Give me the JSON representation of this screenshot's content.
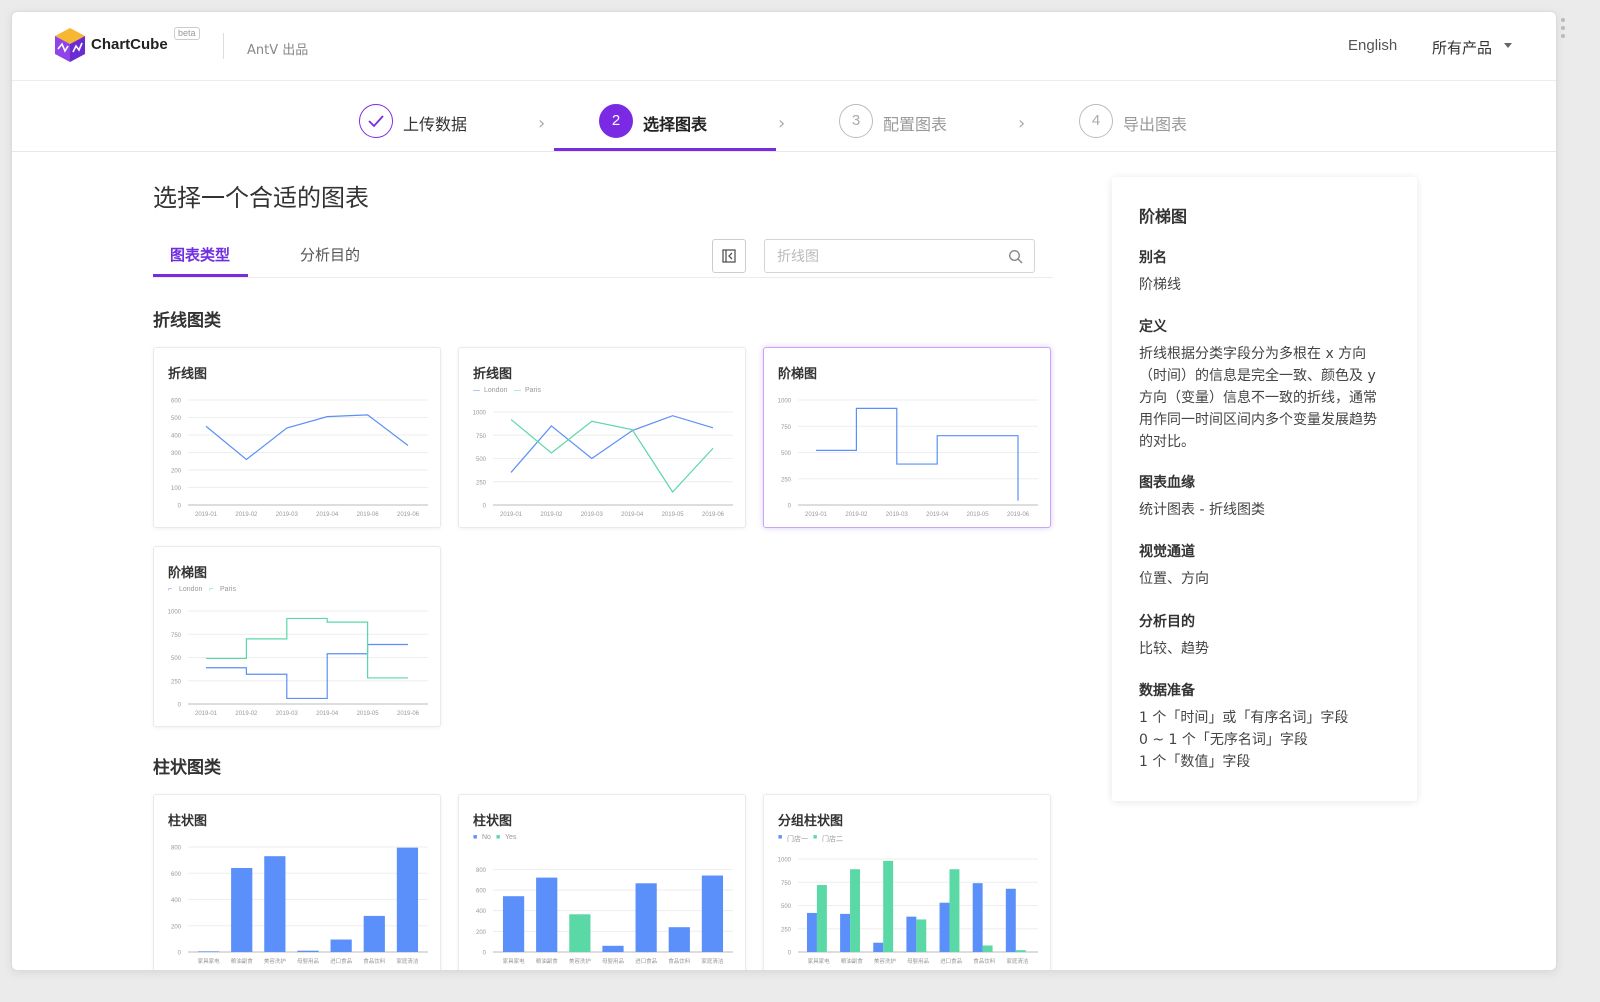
{
  "header": {
    "brand": "ChartCube",
    "beta": "beta",
    "sub": "AntV 出品",
    "lang": "English",
    "products": "所有产品"
  },
  "steps": [
    {
      "num": "",
      "label": "上传数据",
      "state": "done"
    },
    {
      "num": "2",
      "label": "选择图表",
      "state": "active"
    },
    {
      "num": "3",
      "label": "配置图表",
      "state": "todo"
    },
    {
      "num": "4",
      "label": "导出图表",
      "state": "todo"
    }
  ],
  "main": {
    "title": "选择一个合适的图表",
    "tabs": [
      "图表类型",
      "分析目的"
    ],
    "search_placeholder": "折线图"
  },
  "sections": {
    "line": "折线图类",
    "bar": "柱状图类"
  },
  "cards": {
    "c1": {
      "title": "折线图"
    },
    "c2": {
      "title": "折线图",
      "legend": [
        "London",
        "Paris"
      ]
    },
    "c3": {
      "title": "阶梯图"
    },
    "c4": {
      "title": "阶梯图",
      "legend": [
        "London",
        "Paris"
      ]
    },
    "c5": {
      "title": "柱状图"
    },
    "c6": {
      "title": "柱状图",
      "legend": [
        "No",
        "Yes"
      ]
    },
    "c7": {
      "title": "分组柱状图",
      "legend": [
        "门店一",
        "门店二"
      ]
    }
  },
  "detail": {
    "title": "阶梯图",
    "alias_h": "别名",
    "alias": "阶梯线",
    "def_h": "定义",
    "def": "折线根据分类字段分为多根在 x 方向（时间）的信息是完全一致、颜色及 y 方向（变量）信息不一致的折线，通常用作同一时间区间内多个变量发展趋势的对比。",
    "lineage_h": "图表血缘",
    "lineage": "统计图表 - 折线图类",
    "visual_h": "视觉通道",
    "visual": "位置、方向",
    "purpose_h": "分析目的",
    "purpose": "比较、趋势",
    "prep_h": "数据准备",
    "prep": [
      "1 个「时间」或「有序名词」字段",
      "0 ~ 1 个「无序名词」字段",
      "1 个「数值」字段"
    ]
  },
  "colors": {
    "primary": "#7b2ae3",
    "blue": "#5b8ff9",
    "green": "#5ad8a6"
  },
  "chart_data": [
    {
      "type": "line",
      "title": "折线图",
      "x": [
        "2019-01",
        "2019-02",
        "2019-03",
        "2019-04",
        "2019-05",
        "2019-06"
      ],
      "values": [
        450,
        260,
        440,
        505,
        515,
        340
      ],
      "yticks": [
        0,
        100,
        200,
        300,
        400,
        500,
        600
      ],
      "xticks": [
        "2019-01",
        "2019-02",
        "2019-03",
        "2019-04",
        "2019-06",
        "2019-06"
      ],
      "ylim": [
        0,
        600
      ]
    },
    {
      "type": "line",
      "title": "折线图",
      "x": [
        "2019-01",
        "2019-02",
        "2019-03",
        "2019-04",
        "2019-05",
        "2019-06"
      ],
      "series": [
        {
          "name": "London",
          "values": [
            350,
            850,
            500,
            800,
            960,
            830
          ]
        },
        {
          "name": "Paris",
          "values": [
            920,
            560,
            900,
            810,
            140,
            610
          ]
        }
      ],
      "yticks": [
        0,
        250,
        500,
        750,
        1000
      ],
      "xticks": [
        "2019-01",
        "2019-02",
        "2019-03",
        "2019-04",
        "2019-05",
        "2019-06"
      ],
      "ylim": [
        0,
        1000
      ]
    },
    {
      "type": "line",
      "title": "阶梯图",
      "x": [
        "2019-01",
        "2019-02",
        "2019-03",
        "2019-04",
        "2019-05",
        "2019-06"
      ],
      "values": [
        520,
        920,
        390,
        660,
        660,
        40
      ],
      "yticks": [
        0,
        250,
        500,
        750,
        1000
      ],
      "xticks": [
        "2019-01",
        "2019-02",
        "2019-03",
        "2019-04",
        "2019-05",
        "2019-06"
      ],
      "ylim": [
        0,
        1000
      ]
    },
    {
      "type": "line",
      "title": "阶梯图",
      "x": [
        "2019-01",
        "2019-02",
        "2019-03",
        "2019-04",
        "2019-05",
        "2019-06"
      ],
      "series": [
        {
          "name": "London",
          "values": [
            390,
            320,
            60,
            540,
            640,
            640
          ]
        },
        {
          "name": "Paris",
          "values": [
            490,
            700,
            920,
            880,
            280,
            280
          ]
        }
      ],
      "yticks": [
        0,
        250,
        500,
        750,
        1000
      ],
      "xticks": [
        "2019-01",
        "2019-02",
        "2019-03",
        "2019-04",
        "2019-05",
        "2019-06"
      ],
      "ylim": [
        0,
        1000
      ]
    },
    {
      "type": "bar",
      "title": "柱状图",
      "categories": [
        "家具家电",
        "粮油副食",
        "美容洗护",
        "母婴用品",
        "进口食品",
        "食品饮料",
        "家庭清洁"
      ],
      "values": [
        5,
        640,
        730,
        10,
        95,
        275,
        795
      ],
      "yticks": [
        0,
        200,
        400,
        600,
        800
      ],
      "ylim": [
        0,
        800
      ]
    },
    {
      "type": "bar",
      "title": "柱状图",
      "categories": [
        "家具家电",
        "粮油副食",
        "美容洗护",
        "母婴用品",
        "进口食品",
        "食品饮料",
        "家庭清洁"
      ],
      "values": [
        540,
        720,
        365,
        60,
        665,
        240,
        740
      ],
      "highlight": [
        false,
        false,
        true,
        false,
        false,
        false,
        false
      ],
      "yticks": [
        0,
        200,
        400,
        600,
        800
      ],
      "ylim": [
        0,
        900
      ]
    },
    {
      "type": "bar",
      "title": "分组柱状图",
      "categories": [
        "家具家电",
        "粮油副食",
        "美容洗护",
        "母婴用品",
        "进口食品",
        "食品饮料",
        "家庭清洁"
      ],
      "series": [
        {
          "name": "门店一",
          "values": [
            420,
            410,
            100,
            380,
            530,
            740,
            680
          ]
        },
        {
          "name": "门店二",
          "values": [
            720,
            890,
            980,
            350,
            890,
            70,
            20
          ]
        }
      ],
      "yticks": [
        0,
        250,
        500,
        750,
        1000
      ],
      "ylim": [
        0,
        1000
      ]
    }
  ]
}
